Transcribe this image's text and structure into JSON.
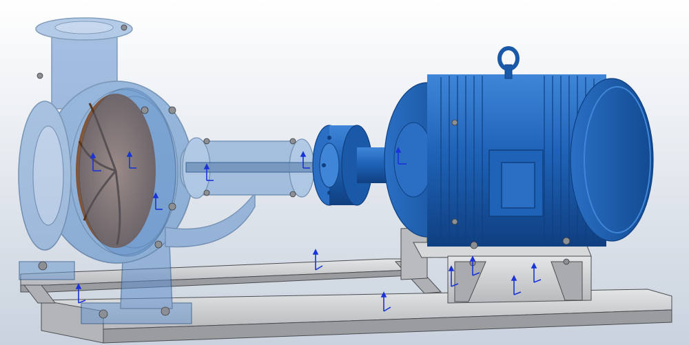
{
  "viewport": {
    "background_top": "#ffffff",
    "background_bottom": "#c9d2de"
  },
  "colors": {
    "pump_transparent": "#4f86c6",
    "pump_edge": "#1f4f86",
    "impeller": "#a8683a",
    "motor": "#1f63b8",
    "motor_dark": "#0f3f80",
    "motor_light": "#3f86d8",
    "frame": "#cfd1d4",
    "frame_dark": "#9a9ca0",
    "frame_edge": "#4a4c50",
    "bolt": "#8c8f93",
    "triad": "#1a33d6"
  },
  "icons": {
    "lifting_eye": "lifting-eye-icon",
    "coordinate_triad": "coordinate-triad-icon"
  }
}
